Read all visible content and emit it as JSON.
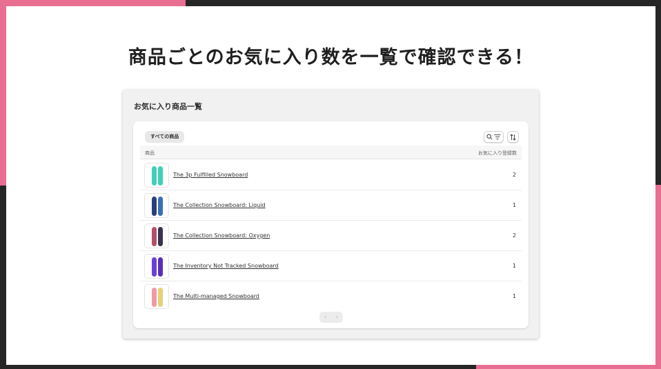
{
  "headline": "商品ごとのお気に入り数を一覧で確認できる！",
  "panel": {
    "title": "お気に入り商品一覧",
    "filter_tab": "すべての商品",
    "search_icon": "search-icon",
    "filter_icon": "filter-icon",
    "sort_icon": "sort-icon"
  },
  "table": {
    "columns": {
      "product": "商品",
      "count": "お気に入り登録数"
    },
    "rows": [
      {
        "name": "The 3p Fulfilled Snowboard",
        "count": "2",
        "colors": [
          "#3fd1b8",
          "#3fd1b8"
        ]
      },
      {
        "name": "The Collection Snowboard: Liquid",
        "count": "1",
        "colors": [
          "#2b3f7a",
          "#3a6fb5"
        ]
      },
      {
        "name": "The Collection Snowboard: Oxygen",
        "count": "2",
        "colors": [
          "#b5506a",
          "#3b3350"
        ]
      },
      {
        "name": "The Inventory Not Tracked Snowboard",
        "count": "1",
        "colors": [
          "#6a3fd8",
          "#5a2fb8"
        ]
      },
      {
        "name": "The Multi-managed Snowboard",
        "count": "1",
        "colors": [
          "#f09aa5",
          "#e6d07a"
        ]
      }
    ]
  },
  "pagination": {
    "prev": "‹",
    "next": "›"
  },
  "colors": {
    "accent": "#e96f92",
    "background": "#262626"
  }
}
